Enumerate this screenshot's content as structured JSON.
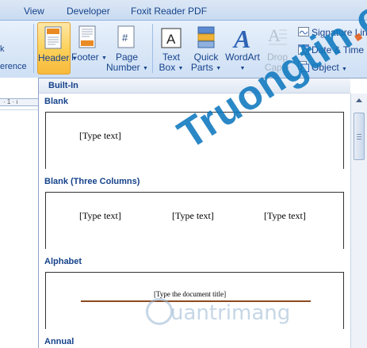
{
  "tabs": [
    "View",
    "Developer",
    "Foxit Reader PDF"
  ],
  "left_fragments": [
    "k",
    "erence"
  ],
  "ribbon": {
    "buttons": [
      {
        "id": "header",
        "label": "Header",
        "has_arrow": true,
        "icon": "header-icon"
      },
      {
        "id": "footer",
        "label": "Footer",
        "has_arrow": true,
        "icon": "footer-icon"
      },
      {
        "id": "page_number",
        "label_1": "Page",
        "label_2": "Number",
        "has_arrow": true,
        "icon": "page-number-icon",
        "glyph": "#"
      },
      {
        "id": "text_box",
        "label_1": "Text",
        "label_2": "Box",
        "has_arrow": true,
        "icon": "text-box-icon",
        "glyph": "A"
      },
      {
        "id": "quick_parts",
        "label_1": "Quick",
        "label_2": "Parts",
        "has_arrow": true,
        "icon": "quick-parts-icon"
      },
      {
        "id": "wordart",
        "label": "WordArt",
        "has_arrow": true,
        "icon": "wordart-icon",
        "glyph": "A"
      },
      {
        "id": "drop_cap",
        "label_1": "Drop",
        "label_2": "Cap",
        "has_arrow": true,
        "icon": "drop-cap-icon",
        "glyph": "A",
        "disabled": true
      }
    ],
    "side_commands": [
      {
        "label": "Signature Line",
        "has_arrow": true,
        "icon": "signature-line-icon"
      },
      {
        "label": "Date & Time",
        "icon": "date-time-icon"
      },
      {
        "label": "Object",
        "has_arrow": true,
        "icon": "object-icon"
      }
    ]
  },
  "ruler_text": "· 1 · ı",
  "gallery": {
    "section_header": "Built-In",
    "items": [
      {
        "name": "Blank",
        "placeholders": [
          "[Type text]"
        ]
      },
      {
        "name": "Blank (Three Columns)",
        "placeholders": [
          "[Type text]",
          "[Type text]",
          "[Type text]"
        ]
      },
      {
        "name": "Alphabet",
        "placeholders": [
          "[Type the document title]"
        ]
      },
      {
        "name": "Annual"
      }
    ]
  },
  "watermark": {
    "main": "Truongtin",
    "dot": ".",
    "suffix": "org",
    "sub": "uantrimang"
  },
  "colors": {
    "accent": "#15428b",
    "active_fill": "#fbd25c",
    "rule": "#8b4a20"
  }
}
